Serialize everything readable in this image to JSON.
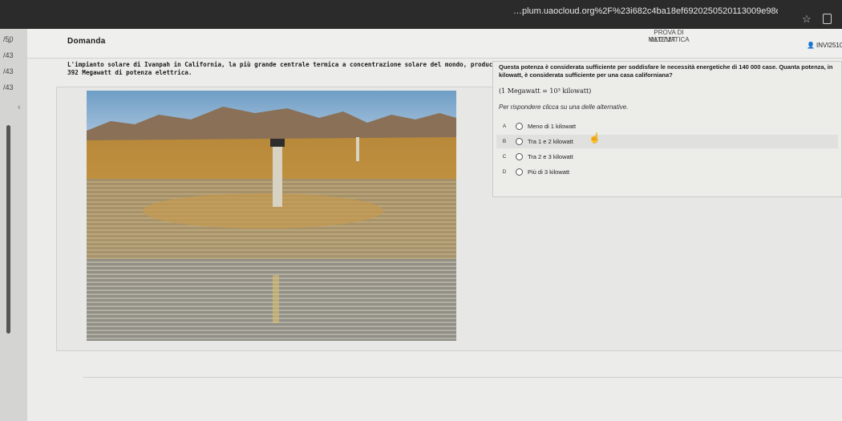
{
  "browser": {
    "url": "…plum.uaocloud.org%2F%23i682c4ba18ef6920250520113009e98d2a0c",
    "star_icon": "star-icon",
    "extension_icon": "puzzle-icon"
  },
  "left_rail": {
    "items": [
      "/50",
      "/43",
      "/43",
      "/43"
    ]
  },
  "header": {
    "section_label": "Domanda",
    "exam_title": "PROVA DI MATEMATICA",
    "timer": "01:07:27",
    "user_code": "INVI2510"
  },
  "stem": {
    "text": "L'impianto solare di Ivanpah in California, la più grande centrale termica a concentrazione solare del mondo, produce 392 Megawatt di potenza elettrica."
  },
  "question": {
    "text": "Questa potenza è considerata sufficiente per soddisfare le necessità energetiche di 140 000 case. Quanta potenza, in kilowatt, è considerata sufficiente per una casa californiana?",
    "note": "(1 Megawatt = 10³ kilowatt)",
    "instruction": "Per rispondere clicca su una delle alternative.",
    "options": [
      {
        "letter": "A",
        "label": "Meno di 1 kilowatt"
      },
      {
        "letter": "B",
        "label": "Tra 1 e 2 kilowatt"
      },
      {
        "letter": "C",
        "label": "Tra 2 e 3 kilowatt"
      },
      {
        "letter": "D",
        "label": "Più di 3 kilowatt"
      }
    ]
  }
}
